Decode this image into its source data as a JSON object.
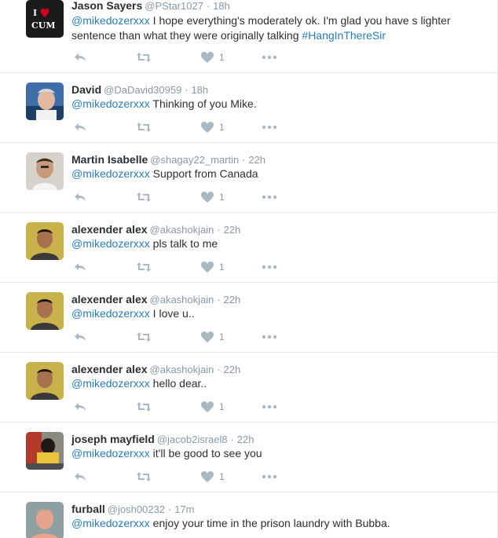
{
  "tweets": [
    {
      "name": "Jason Sayers",
      "handle": "@PStar1027",
      "time": "18h",
      "mention": "@mikedozerxxx",
      "body": " I hope everything's moderately ok. I'm glad you have s lighter sentence than what they were originally talking ",
      "hashtag": "#HangInThereSir",
      "likes": "1",
      "avatar_text": "I ❤ CUM"
    },
    {
      "name": "David",
      "handle": "@DaDavid30959",
      "time": "18h",
      "mention": "@mikedozerxxx",
      "body": " Thinking of you Mike.",
      "hashtag": "",
      "likes": "1"
    },
    {
      "name": "Martin Isabelle",
      "handle": "@shagay22_martin",
      "time": "22h",
      "mention": "@mikedozerxxx",
      "body": " Support from Canada",
      "hashtag": "",
      "likes": "1"
    },
    {
      "name": "alexender alex",
      "handle": "@akashokjain",
      "time": "22h",
      "mention": "@mikedozerxxx",
      "body": " pls talk to me",
      "hashtag": "",
      "likes": "1"
    },
    {
      "name": "alexender alex",
      "handle": "@akashokjain",
      "time": "22h",
      "mention": "@mikedozerxxx",
      "body": " I love u..",
      "hashtag": "",
      "likes": "1"
    },
    {
      "name": "alexender alex",
      "handle": "@akashokjain",
      "time": "22h",
      "mention": "@mikedozerxxx",
      "body": " hello dear..",
      "hashtag": "",
      "likes": "1"
    },
    {
      "name": "joseph mayfield",
      "handle": "@jacob2israel8",
      "time": "22h",
      "mention": "@mikedozerxxx",
      "body": " it'll be good to see you",
      "hashtag": "",
      "likes": "1"
    },
    {
      "name": "furball",
      "handle": "@josh00232",
      "time": "17m",
      "mention": "@mikedozerxxx",
      "body": " enjoy your time in the prison laundry with Bubba.",
      "hashtag": "",
      "likes": ""
    }
  ],
  "separator": "·",
  "colors": {
    "link": "#2b7bb9",
    "muted": "#8899a6",
    "icon": "#aab8c2",
    "border": "#e1e8ed"
  },
  "icons": {
    "reply": "reply-icon",
    "retweet": "retweet-icon",
    "like": "heart-icon",
    "more": "more-dots-icon"
  }
}
